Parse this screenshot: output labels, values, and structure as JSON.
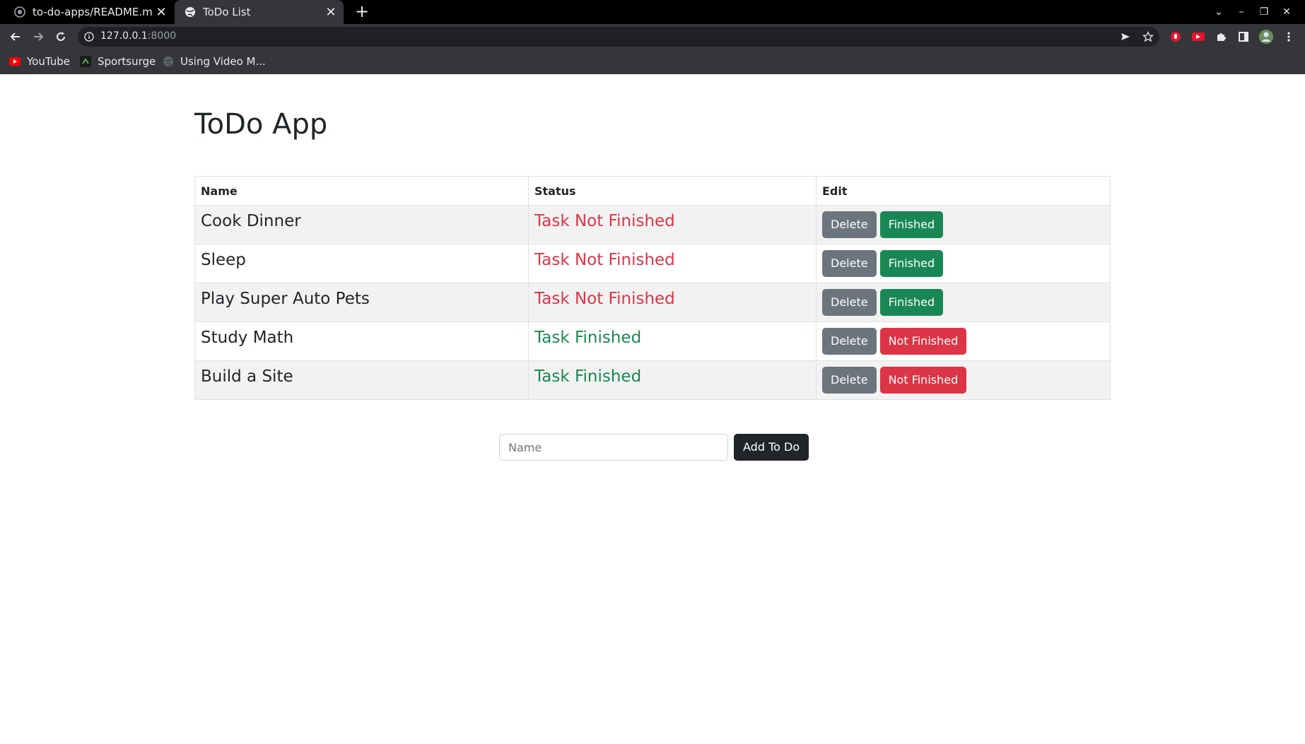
{
  "browser": {
    "tabs": [
      {
        "title": "to-do-apps/README.md at",
        "active": false,
        "icon": "github-icon"
      },
      {
        "title": "ToDo List",
        "active": true,
        "icon": "globe-icon"
      }
    ],
    "url": {
      "host": "127.0.0.1",
      "port": ":8000"
    },
    "bookmarks": [
      {
        "label": "YouTube",
        "icon": "youtube-icon"
      },
      {
        "label": "Sportsurge",
        "icon": "sportsurge-icon"
      },
      {
        "label": "Using Video M...",
        "icon": "globe-icon"
      }
    ]
  },
  "app": {
    "title": "ToDo App",
    "table": {
      "headers": [
        "Name",
        "Status",
        "Edit"
      ],
      "rows": [
        {
          "name": "Cook Dinner",
          "status": "Task Not Finished",
          "done": false,
          "delete_label": "Delete",
          "toggle_label": "Finished"
        },
        {
          "name": "Sleep",
          "status": "Task Not Finished",
          "done": false,
          "delete_label": "Delete",
          "toggle_label": "Finished"
        },
        {
          "name": "Play Super Auto Pets",
          "status": "Task Not Finished",
          "done": false,
          "delete_label": "Delete",
          "toggle_label": "Finished"
        },
        {
          "name": "Study Math",
          "status": "Task Finished",
          "done": true,
          "delete_label": "Delete",
          "toggle_label": "Not Finished"
        },
        {
          "name": "Build a Site",
          "status": "Task Finished",
          "done": true,
          "delete_label": "Delete",
          "toggle_label": "Not Finished"
        }
      ]
    },
    "form": {
      "name_placeholder": "Name",
      "name_value": "",
      "submit_label": "Add To Do"
    }
  },
  "colors": {
    "danger": "#dc3545",
    "success": "#198754",
    "secondary": "#6c757d",
    "dark": "#212529"
  }
}
